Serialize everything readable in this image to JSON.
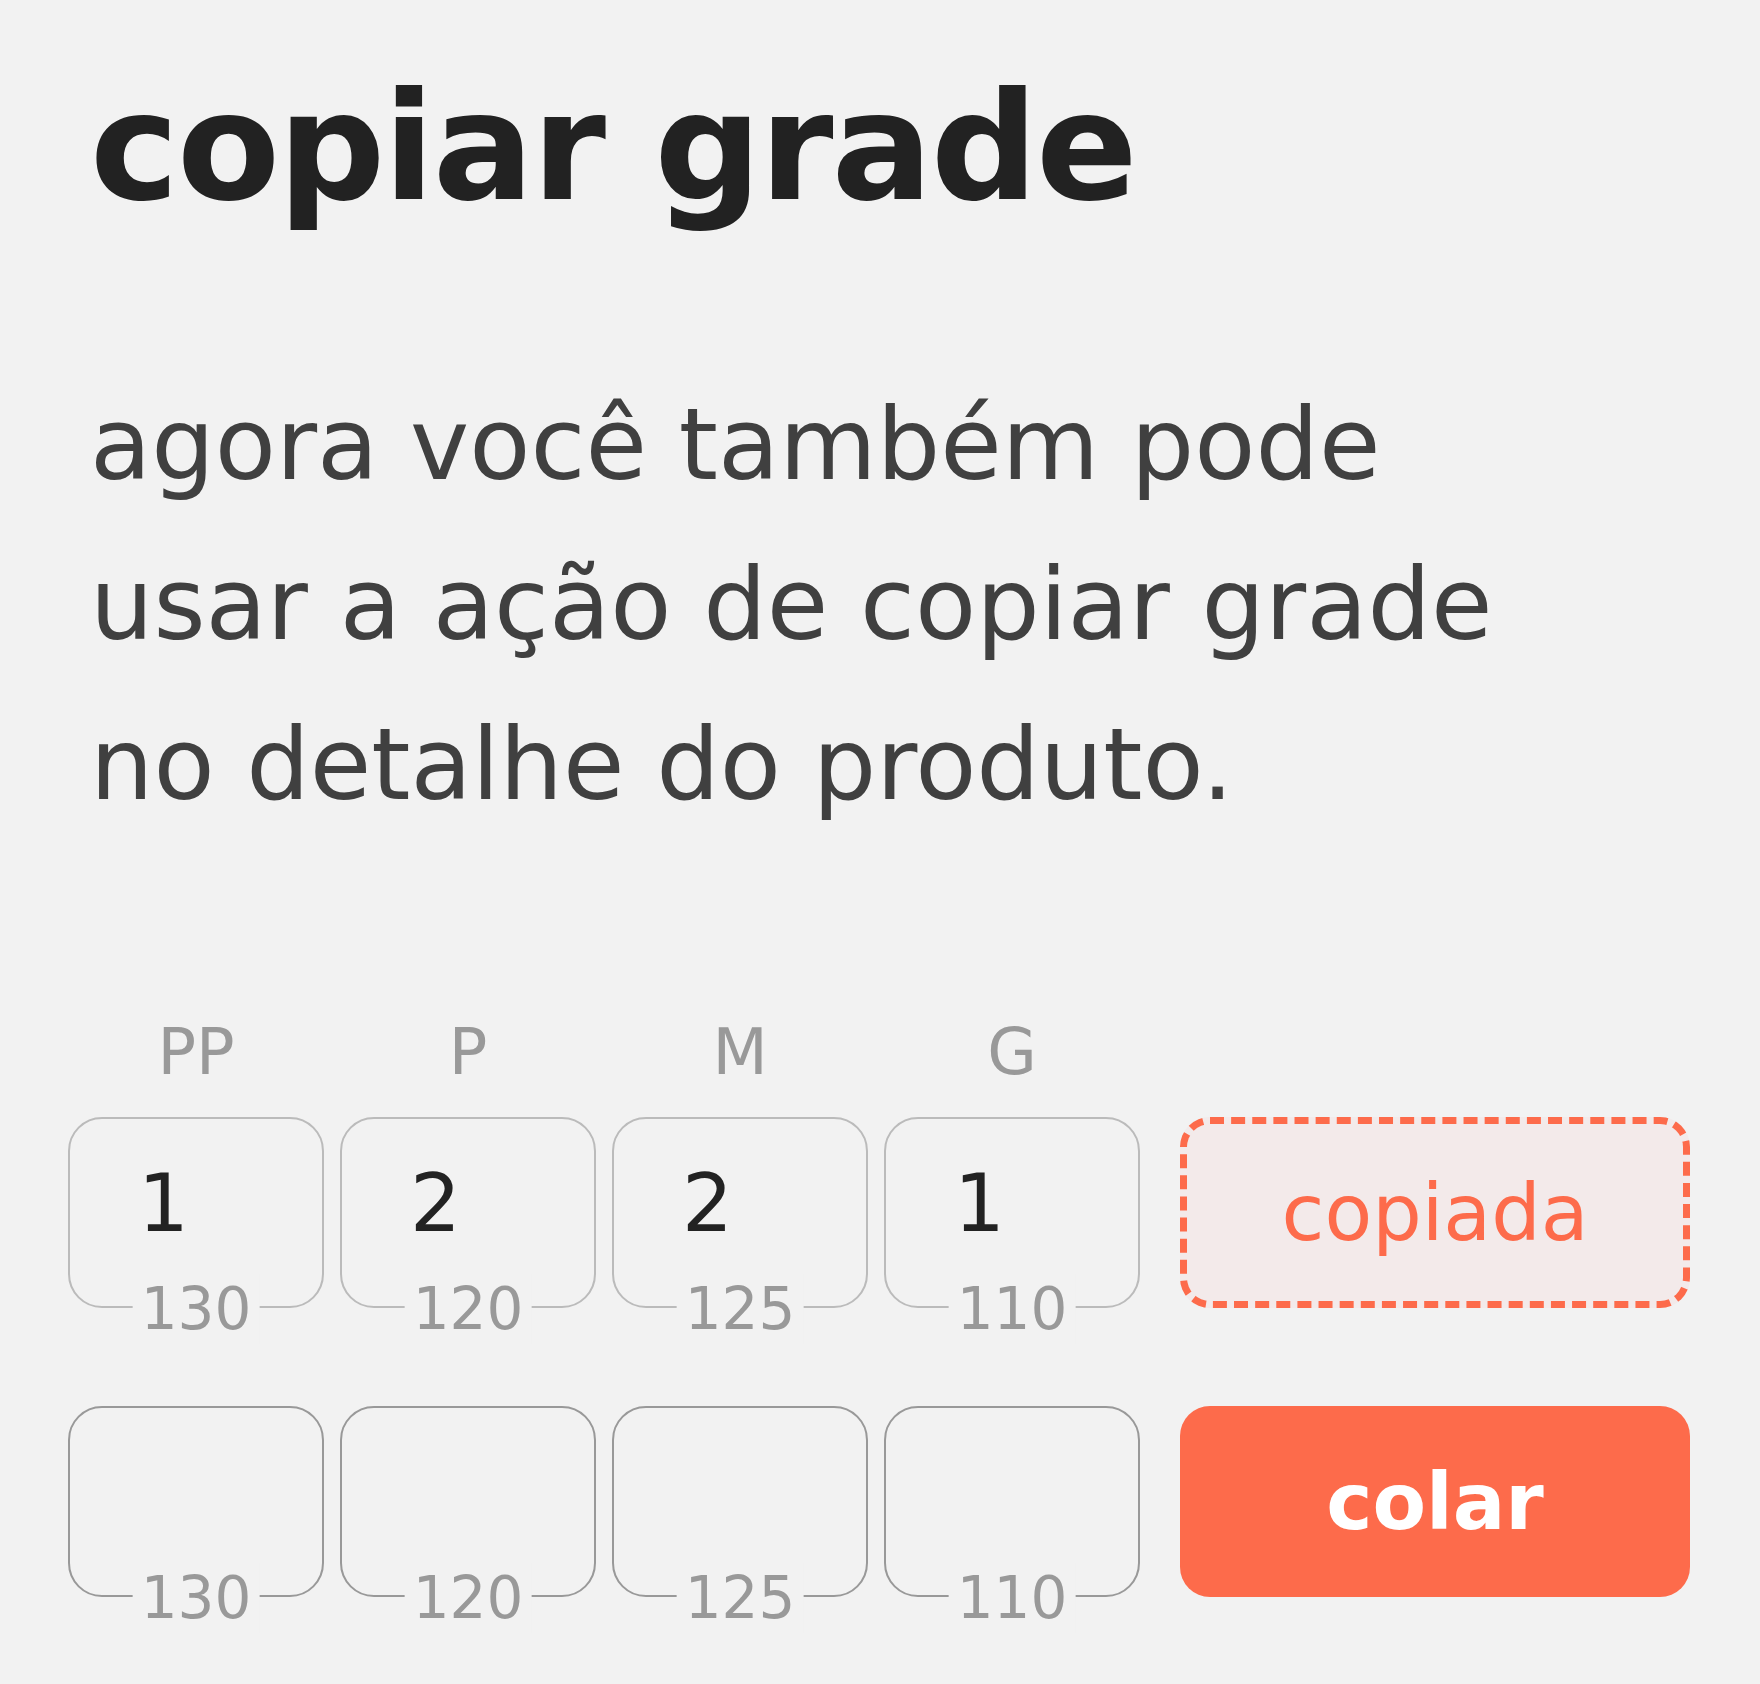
{
  "title": "copiar grade",
  "description": "agora você também pode usar a ação de copiar grade no detalhe do produto.",
  "sizes": [
    "PP",
    "P",
    "M",
    "G"
  ],
  "rows": [
    {
      "cells": [
        {
          "value": "1",
          "note": "130"
        },
        {
          "value": "2",
          "note": "120"
        },
        {
          "value": "2",
          "note": "125"
        },
        {
          "value": "1",
          "note": "110"
        }
      ],
      "action": {
        "kind": "copied",
        "label": "copiada"
      }
    },
    {
      "cells": [
        {
          "note": "130"
        },
        {
          "note": "120"
        },
        {
          "note": "125"
        },
        {
          "note": "110"
        }
      ],
      "action": {
        "kind": "paste",
        "label": "colar"
      }
    }
  ]
}
